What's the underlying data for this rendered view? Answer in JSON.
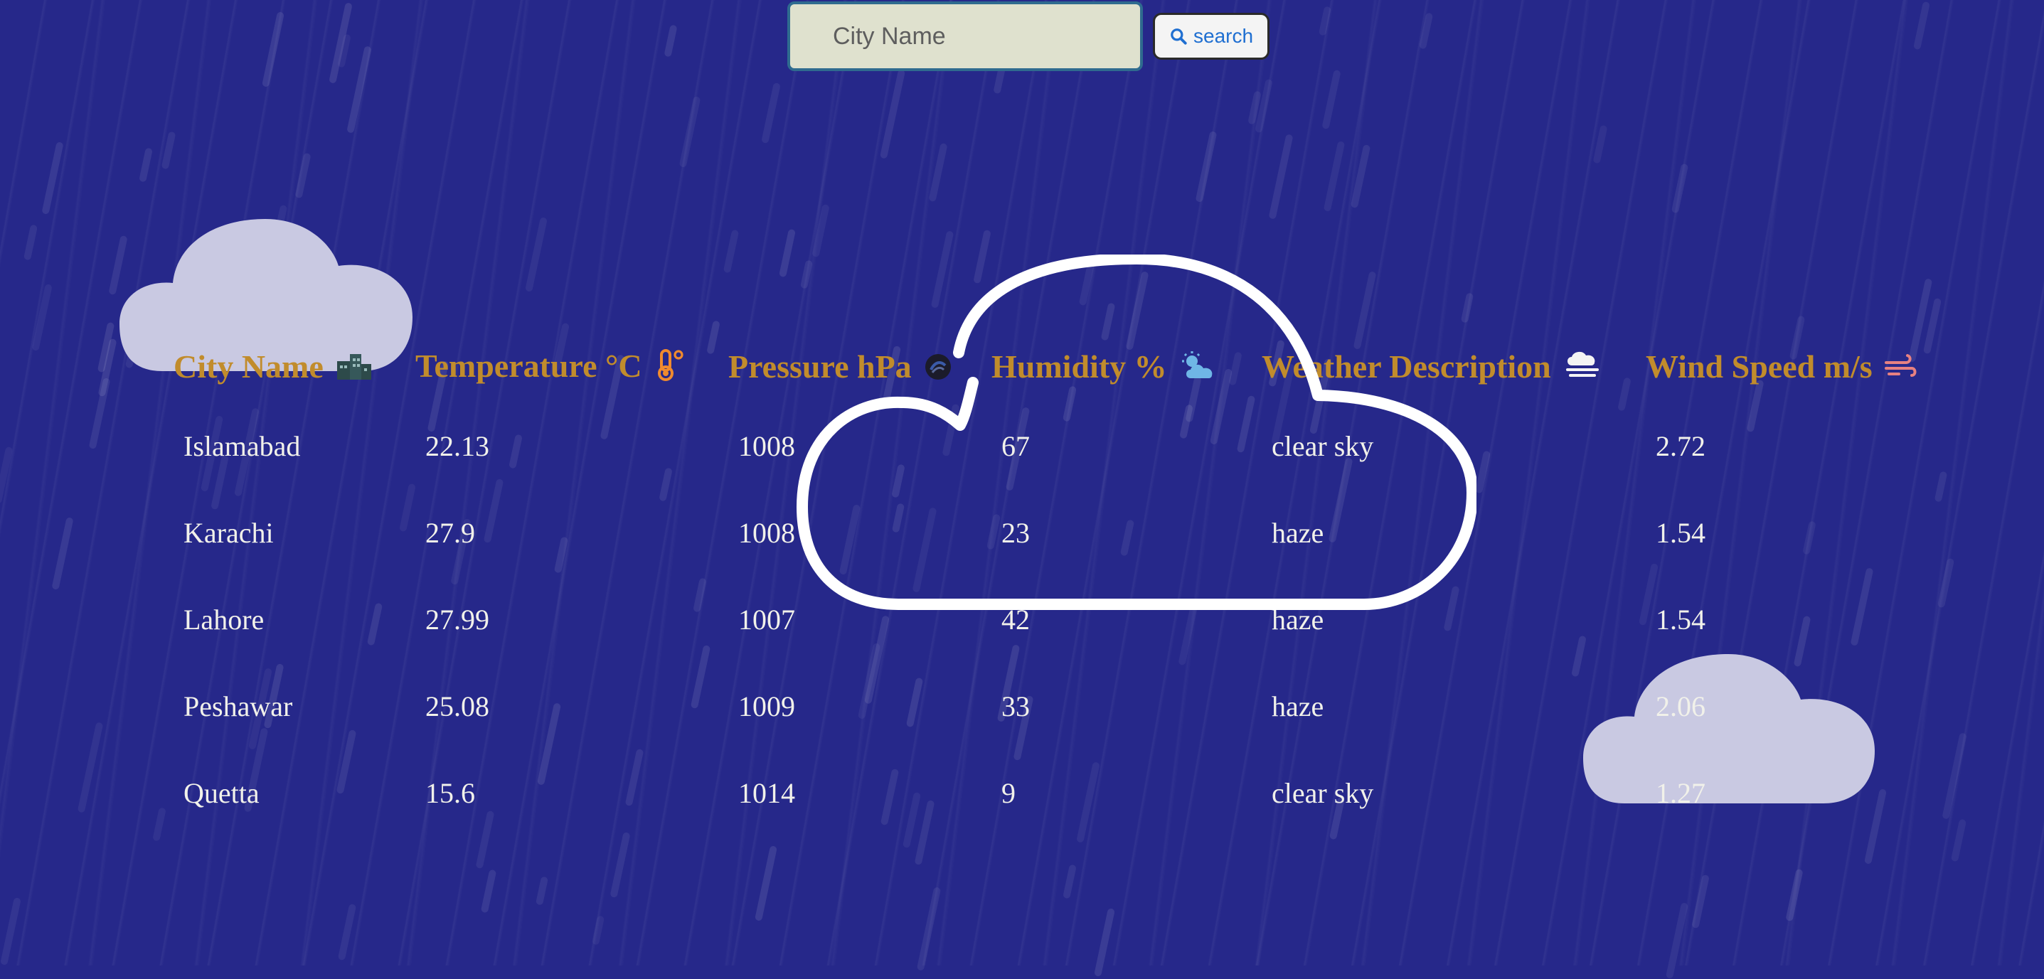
{
  "search": {
    "placeholder": "City Name",
    "button_label": "search",
    "button_icon": "search-icon"
  },
  "table": {
    "headers": [
      {
        "label": "City Name",
        "icon": "city-icon"
      },
      {
        "label": "Temperature °C",
        "icon": "thermometer-icon"
      },
      {
        "label": "Pressure hPa",
        "icon": "pressure-icon"
      },
      {
        "label": "Humidity %",
        "icon": "sun-cloud-icon"
      },
      {
        "label": "Weather Description",
        "icon": "fog-icon"
      },
      {
        "label": "Wind Speed m/s",
        "icon": "wind-icon"
      }
    ],
    "rows": [
      [
        "Islamabad",
        "22.13",
        "1008",
        "67",
        "clear sky",
        "2.72"
      ],
      [
        "Karachi",
        "27.9",
        "1008",
        "23",
        "haze",
        "1.54"
      ],
      [
        "Lahore",
        "27.99",
        "1007",
        "42",
        "haze",
        "1.54"
      ],
      [
        "Peshawar",
        "25.08",
        "1009",
        "33",
        "haze",
        "2.06"
      ],
      [
        "Quetta",
        "15.6",
        "1014",
        "9",
        "clear sky",
        "1.27"
      ]
    ]
  },
  "colors": {
    "background": "#26288a",
    "header_text": "#c18c2c",
    "cell_text": "#f1f1ea",
    "search_bg": "#dfe1ce",
    "search_border": "#2f6b8f",
    "button_text": "#1f6fd1"
  }
}
